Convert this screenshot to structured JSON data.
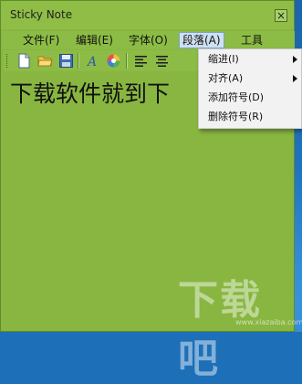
{
  "window": {
    "title": "Sticky Note",
    "close_label": "×"
  },
  "menubar": {
    "items": [
      {
        "label": "文件(F)"
      },
      {
        "label": "编辑(E)"
      },
      {
        "label": "字体(O)"
      },
      {
        "label": "段落(A)",
        "active": true
      },
      {
        "label": "工具"
      }
    ]
  },
  "toolbar": {
    "buttons": [
      "new-file-icon",
      "open-folder-icon",
      "save-icon",
      "font-icon",
      "color-palette-icon",
      "align-left-icon",
      "align-center-icon"
    ]
  },
  "content": {
    "text": "下载软件就到下"
  },
  "dropdown": {
    "items": [
      {
        "label": "缩进(I)",
        "submenu": true
      },
      {
        "label": "对齐(A)",
        "submenu": true
      },
      {
        "label": "添加符号(D)",
        "submenu": false
      },
      {
        "label": "删除符号(R)",
        "submenu": false
      }
    ]
  },
  "watermark": {
    "text": "下载吧",
    "url": "www.xiazaiba.com"
  },
  "colors": {
    "window_bg": "#88b641",
    "desktop_bg": "#1d6fb8",
    "menu_active_bg": "#cfe1ef",
    "dropdown_bg": "#f2f2f2"
  }
}
